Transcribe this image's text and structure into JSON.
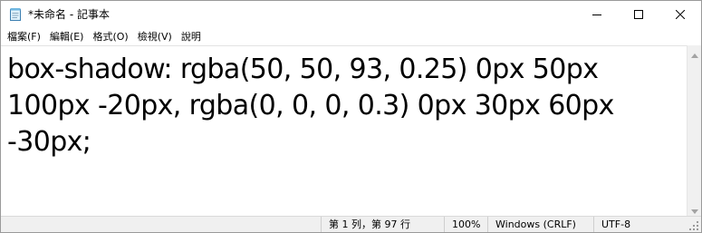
{
  "window": {
    "title": "*未命名 - 記事本",
    "controls": {
      "minimize_icon": "minimize-icon",
      "maximize_icon": "maximize-icon",
      "close_icon": "close-icon"
    }
  },
  "menu": {
    "items": [
      {
        "label": "檔案(F)"
      },
      {
        "label": "編輯(E)"
      },
      {
        "label": "格式(O)"
      },
      {
        "label": "檢視(V)"
      },
      {
        "label": "說明"
      }
    ]
  },
  "editor": {
    "content": "box-shadow: rgba(50, 50, 93, 0.25) 0px 50px 100px -20px, rgba(0, 0, 0, 0.3) 0px 30px 60px -30px;"
  },
  "statusbar": {
    "position": "第 1 列，第 97 行",
    "zoom": "100%",
    "line_ending": "Windows (CRLF)",
    "encoding": "UTF-8"
  },
  "colors": {
    "window_bg": "#ffffff",
    "statusbar_bg": "#f0f0f0",
    "border": "#9a9a9a"
  }
}
